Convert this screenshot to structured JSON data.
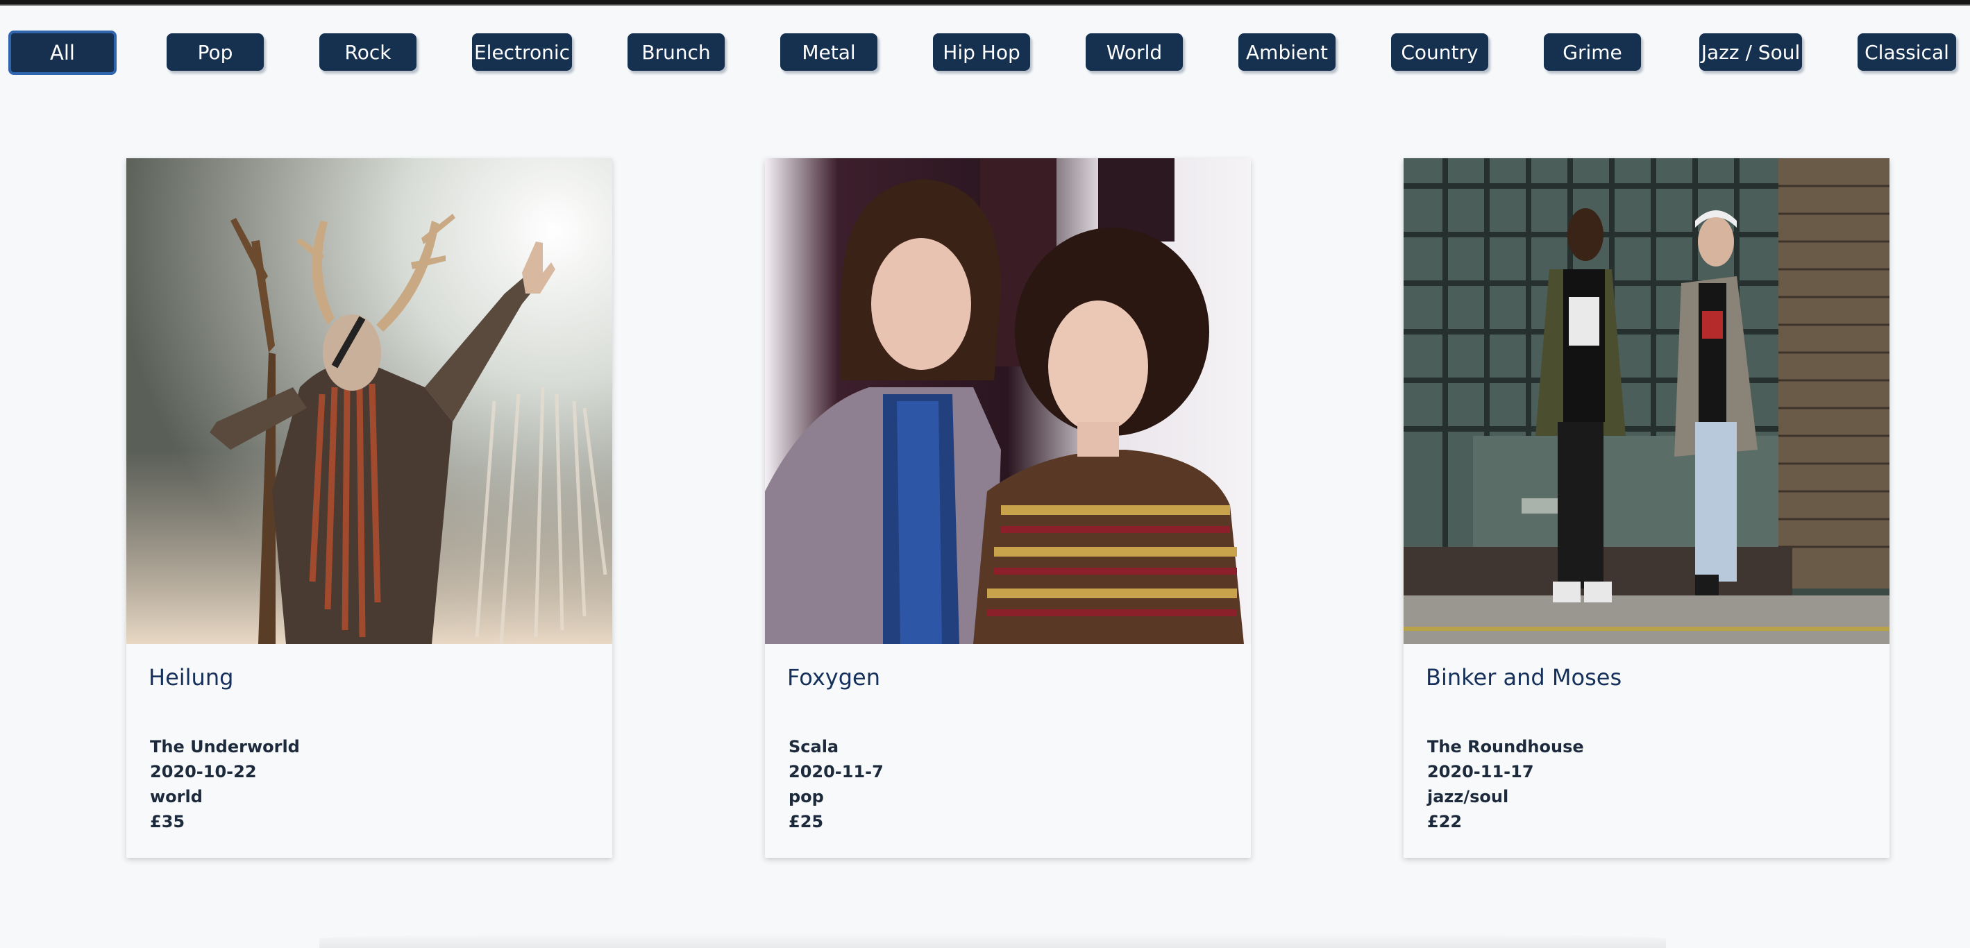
{
  "filters": [
    {
      "label": "All",
      "active": true
    },
    {
      "label": "Pop",
      "active": false
    },
    {
      "label": "Rock",
      "active": false
    },
    {
      "label": "Electronic",
      "active": false
    },
    {
      "label": "Brunch",
      "active": false
    },
    {
      "label": "Metal",
      "active": false
    },
    {
      "label": "Hip Hop",
      "active": false
    },
    {
      "label": "World",
      "active": false
    },
    {
      "label": "Ambient",
      "active": false
    },
    {
      "label": "Country",
      "active": false
    },
    {
      "label": "Grime",
      "active": false
    },
    {
      "label": "Jazz / Soul",
      "active": false
    },
    {
      "label": "Classical",
      "active": false
    }
  ],
  "events": [
    {
      "artist": "Heilung",
      "venue": "The Underworld",
      "date": "2020-10-22",
      "genre": "world",
      "price": "£35",
      "image": "performer-with-antlers-photo"
    },
    {
      "artist": "Foxygen",
      "venue": "Scala",
      "date": "2020-11-7",
      "genre": "pop",
      "price": "£25",
      "image": "two-musicians-portrait-photo"
    },
    {
      "artist": "Binker and Moses",
      "venue": "The Roundhouse",
      "date": "2020-11-17",
      "genre": "jazz/soul",
      "price": "£22",
      "image": "duo-against-window-wall-photo"
    }
  ],
  "colors": {
    "button_bg": "#16304f",
    "button_active_border": "#2f65ad",
    "title_text": "#15305a",
    "page_bg": "#f6f8fa"
  }
}
